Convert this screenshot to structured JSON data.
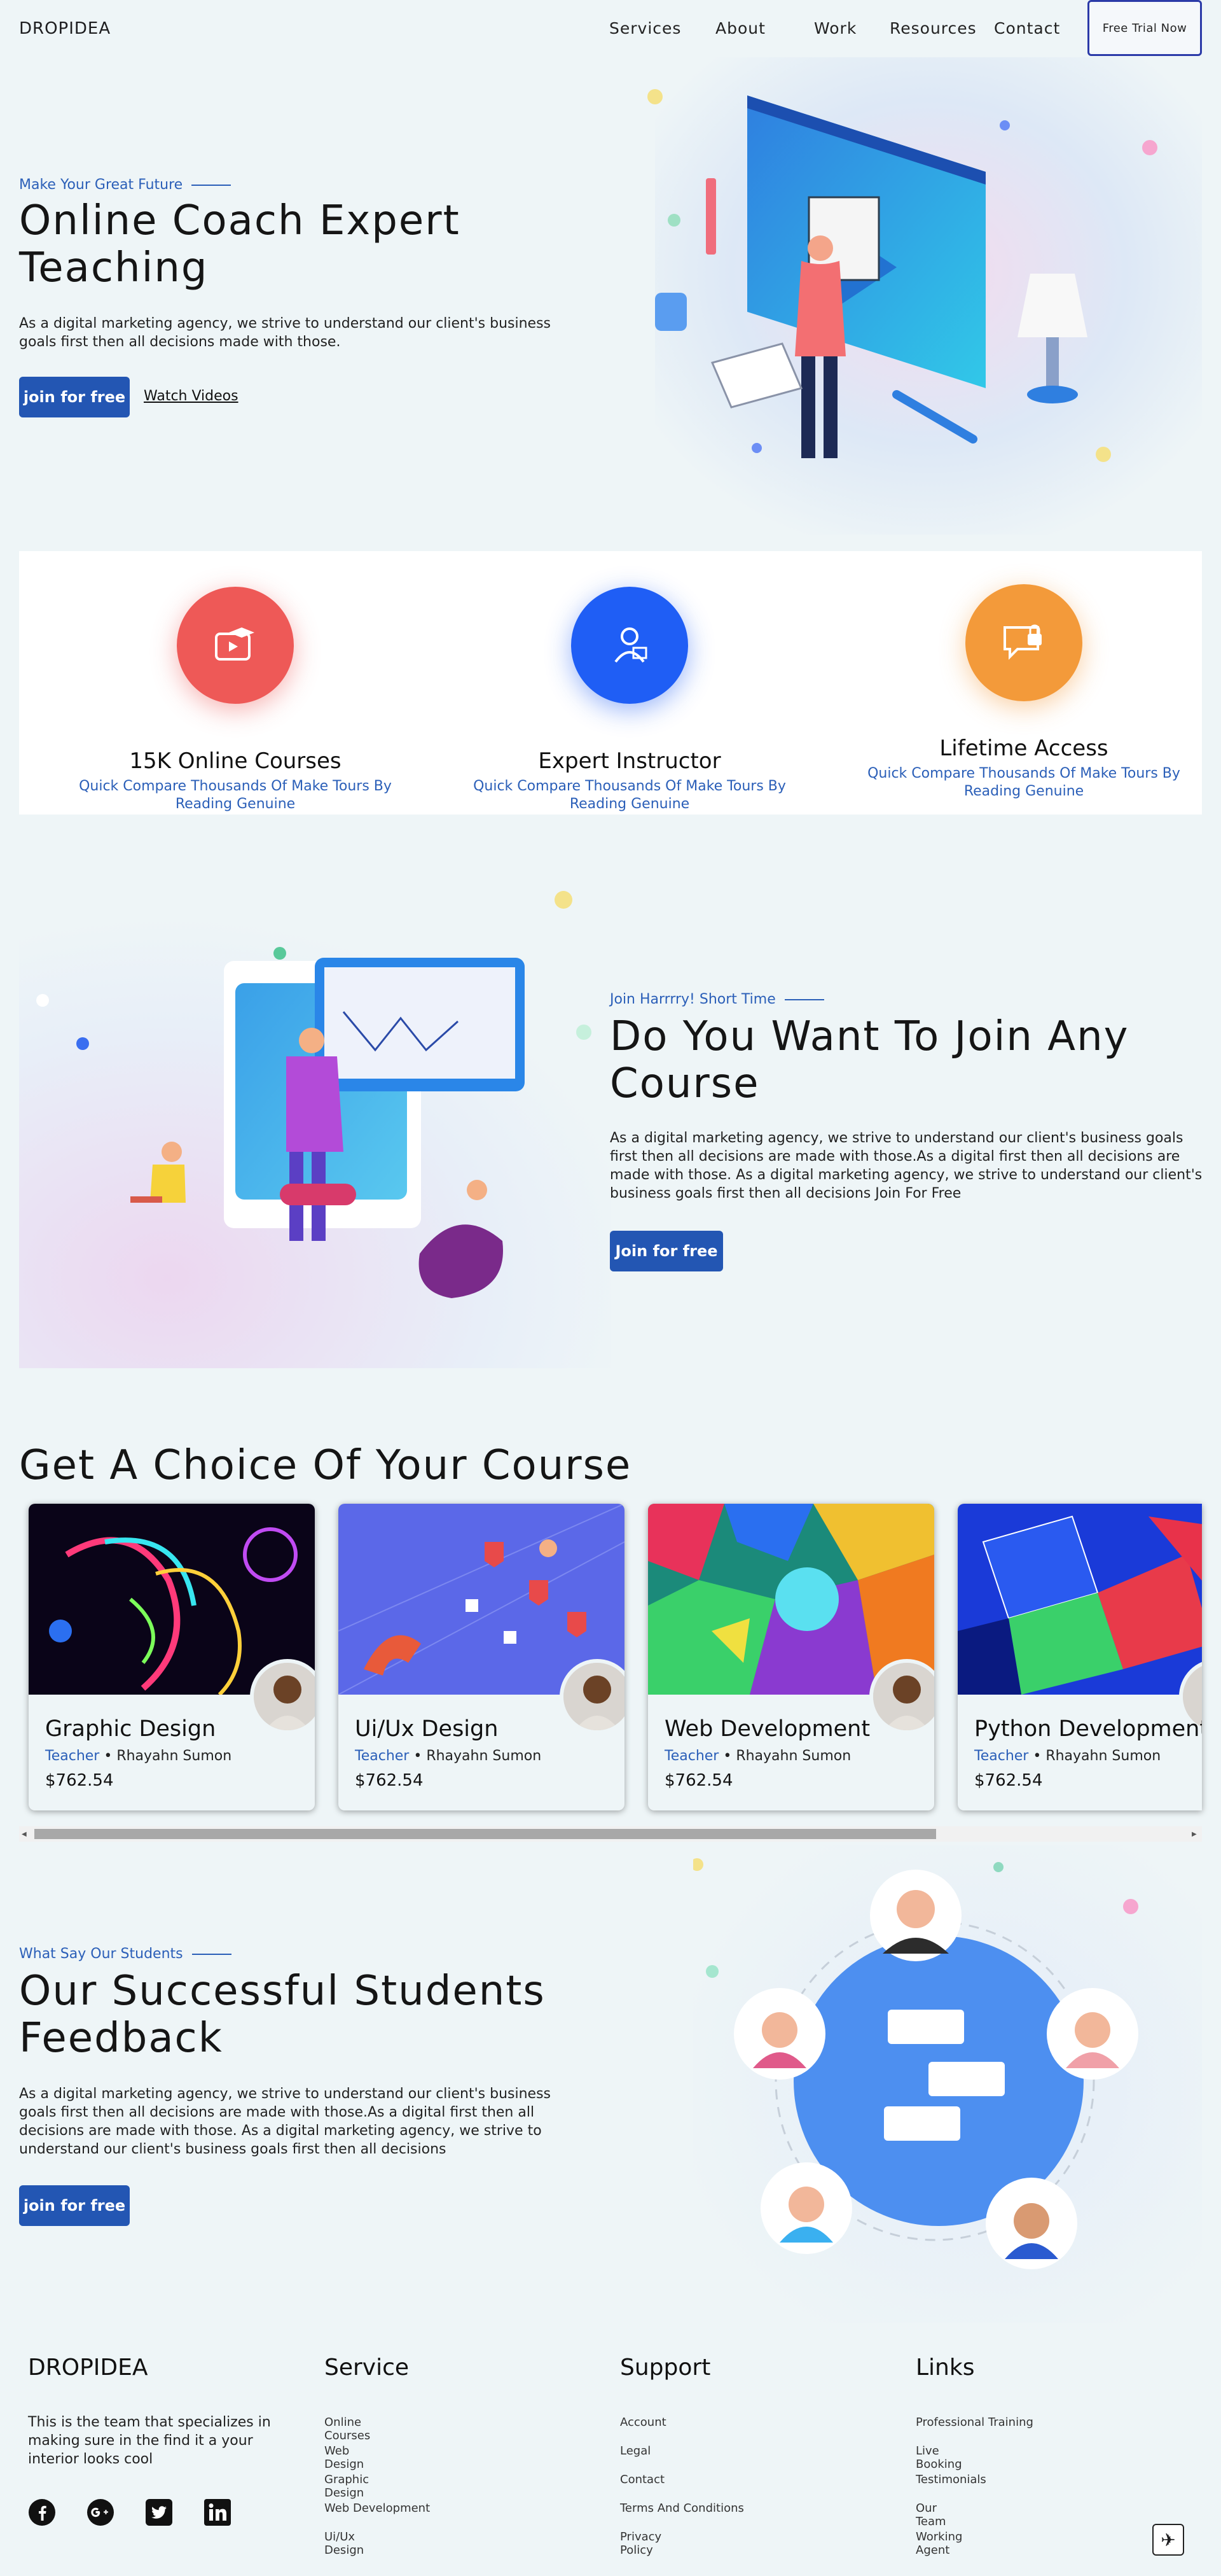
{
  "brand": "DROPIDEA",
  "nav": {
    "services": "Services",
    "about": "About",
    "work": "Work",
    "resources": "Resources",
    "contact": "Contact",
    "trial": "Free Trial Now"
  },
  "hero": {
    "eyebrow": "Make Your Great Future",
    "title_line1": "Online Coach Expert",
    "title_line2": "Teaching",
    "desc": "As a digital marketing agency, we strive to understand our client's business goals first then all decisions made with those.",
    "cta": "join for free",
    "watch": "Watch Videos"
  },
  "features": [
    {
      "title": "15K Online Courses",
      "sub": "Quick Compare Thousands Of Make Tours By Reading Genuine",
      "color": "#ee5957",
      "icon": "video-course-icon"
    },
    {
      "title": "Expert Instructor",
      "sub": "Quick Compare Thousands Of Make Tours By Reading Genuine",
      "color": "#1f5ef5",
      "icon": "instructor-icon"
    },
    {
      "title": "Lifetime Access",
      "sub": "Quick Compare Thousands Of Make Tours By Reading Genuine",
      "color": "#f39a3a",
      "icon": "chat-lock-icon"
    }
  ],
  "join": {
    "eyebrow": "Join Harrrry! Short Time",
    "title_line1": "Do You Want To Join Any",
    "title_line2": "Course",
    "desc": "As a digital marketing agency, we strive to understand our client's business goals first then all decisions are made with those.As a digital first then all decisions are made with those. As a digital marketing agency, we strive to understand our client's business goals first then all decisions Join For Free",
    "cta": "Join for free"
  },
  "courses": {
    "title": "Get A Choice Of Your Course",
    "teacher_role": "Teacher",
    "items": [
      {
        "title": "Graphic Design",
        "teacher": "Rhayahn Sumon",
        "price": "$762.54"
      },
      {
        "title": "Ui/Ux Design",
        "teacher": "Rhayahn Sumon",
        "price": "$762.54"
      },
      {
        "title": "Web Development",
        "teacher": "Rhayahn Sumon",
        "price": "$762.54"
      },
      {
        "title": "Python Development",
        "teacher": "Rhayahn Sumon",
        "price": "$762.54"
      }
    ]
  },
  "feedback": {
    "eyebrow": "What Say Our Students",
    "title_line1": "Our Successful Students",
    "title_line2": "Feedback",
    "desc": "As a digital marketing agency, we strive to understand our client's business goals first then all decisions are made with those.As a digital first then all decisions are made with those. As a digital marketing agency, we strive to understand our client's business goals first then all decisions",
    "cta": "join for free"
  },
  "footer": {
    "brand": "DROPIDEA",
    "about": "This is the team that specializes in making sure in the find it a your interior looks cool",
    "service_title": "Service",
    "service": [
      "Online Courses",
      "Web Design",
      "Graphic Design",
      "Web Development",
      "Ui/Ux Design"
    ],
    "support_title": "Support",
    "support": [
      "Account",
      "Legal",
      "Contact",
      "Terms And Conditions",
      "Privacy Policy"
    ],
    "links_title": "Links",
    "links": [
      "Professional Training",
      "Live Booking",
      "Testimonials",
      "Our Team",
      "Working Agent"
    ],
    "social": [
      "facebook-icon",
      "google-plus-icon",
      "twitter-icon",
      "linkedin-icon"
    ]
  }
}
